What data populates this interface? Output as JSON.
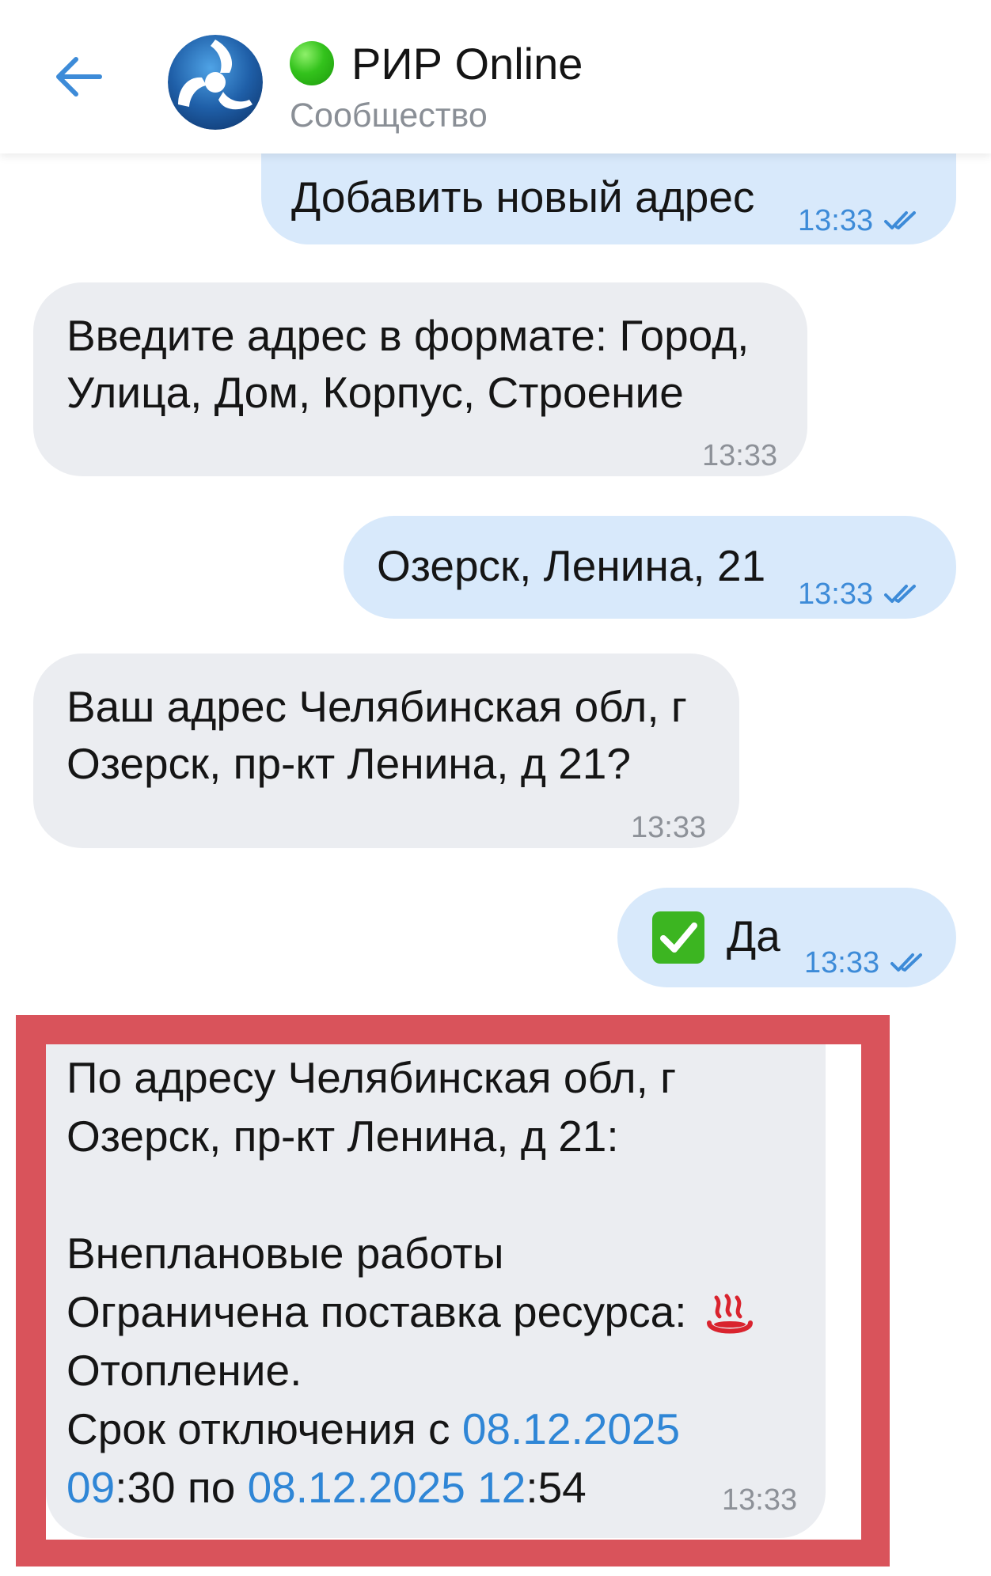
{
  "header": {
    "title": "РИР Online",
    "subtitle": "Сообщество"
  },
  "messages": [
    {
      "direction": "out",
      "text": "Добавить новый адрес",
      "time": "13:33"
    },
    {
      "direction": "in",
      "lines": [
        "Введите адрес в формате: Город,",
        "Улица, Дом, Корпус, Строение"
      ],
      "time": "13:33"
    },
    {
      "direction": "out",
      "text": "Озерск, Ленина, 21",
      "time": "13:33"
    },
    {
      "direction": "in",
      "lines": [
        "Ваш адрес Челябинская обл, г",
        "Озерск, пр-кт Ленина, д 21?"
      ],
      "time": "13:33"
    },
    {
      "direction": "out",
      "emoji": "✅",
      "text": "Да",
      "time": "13:33"
    }
  ],
  "highlighted_message": {
    "line1": "По адресу Челябинская обл, г",
    "line2": "Озерск, пр-кт Ленина, д 21:",
    "line3": "Внеплановые работы",
    "line4": "Ограничена поставка ресурса:",
    "line5": "Отопление.",
    "line6_prefix": "Срок отключения с ",
    "line6_link": "08.12.2025",
    "line7_link1": "09",
    "line7_mid1": ":30 по ",
    "line7_link2": "08.12.2025 12",
    "line7_mid2": ":54",
    "time": "13:33",
    "frame_color": "#d9535b"
  },
  "colors": {
    "outgoing_bubble": "#d8e9fb",
    "incoming_bubble": "#ebedf1",
    "accent": "#3d8bd8",
    "online": "#33c21c"
  }
}
